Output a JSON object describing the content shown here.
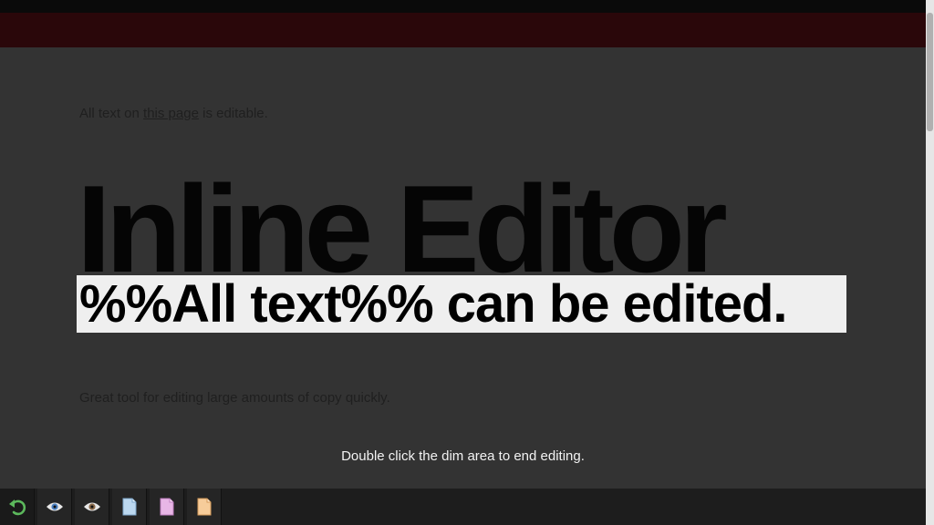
{
  "intro": {
    "prefix": "All text on ",
    "link": "this page",
    "suffix": " is editable."
  },
  "headline": "Inline Editor",
  "editor": {
    "value": "%%All text%% can be edited."
  },
  "subtext": "Great tool for editing large amounts of copy quickly.",
  "hint": "Double click the dim area to end editing.",
  "toolbar": {
    "buttons": [
      {
        "icon": "undo-icon",
        "color": "#5cb85c"
      },
      {
        "icon": "eye-icon",
        "color": "#4a7fc0"
      },
      {
        "icon": "eye-icon",
        "color": "#8a6a4a"
      },
      {
        "icon": "document-icon",
        "color": "#bcd8f0"
      },
      {
        "icon": "document-icon",
        "color": "#e8b6e6"
      },
      {
        "icon": "document-icon",
        "color": "#f6cc9a"
      }
    ]
  },
  "colors": {
    "background": "#333333",
    "header_red": "#2a070a",
    "editor_bg": "#efefef"
  }
}
